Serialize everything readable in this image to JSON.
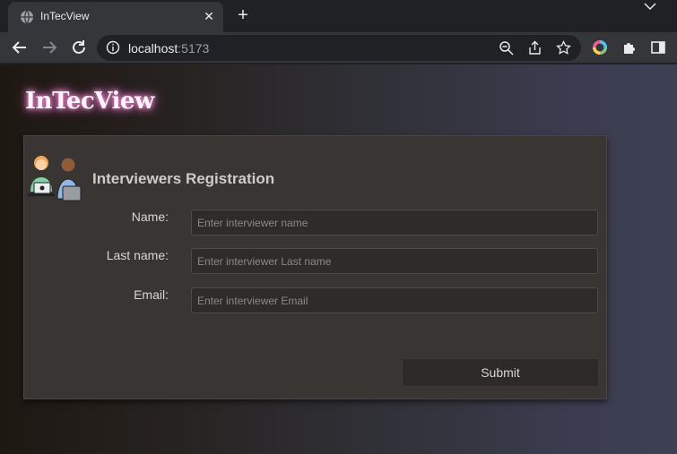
{
  "browser": {
    "tab_title": "InTecView",
    "url_host": "localhost",
    "url_port": ":5173"
  },
  "app": {
    "brand": "InTecView",
    "form": {
      "title": "Interviewers Registration",
      "fields": [
        {
          "label": "Name:",
          "placeholder": "Enter interviewer name",
          "value": ""
        },
        {
          "label": "Last name:",
          "placeholder": "Enter interviewer Last name",
          "value": ""
        },
        {
          "label": "Email:",
          "placeholder": "Enter interviewer Email",
          "value": ""
        }
      ],
      "submit_label": "Submit"
    }
  },
  "colors": {
    "brand_glow": "#d06bb4",
    "card_bg": "#393532",
    "input_bg": "#2e2b29"
  },
  "icons": [
    "globe-icon",
    "close-icon",
    "new-tab-icon",
    "tab-menu-icon",
    "back-icon",
    "forward-icon",
    "reload-icon",
    "site-info-icon",
    "zoom-icon",
    "share-icon",
    "bookmark-star-icon",
    "color-extension-icon",
    "extensions-puzzle-icon",
    "side-panel-icon",
    "interviewers-illustration"
  ]
}
